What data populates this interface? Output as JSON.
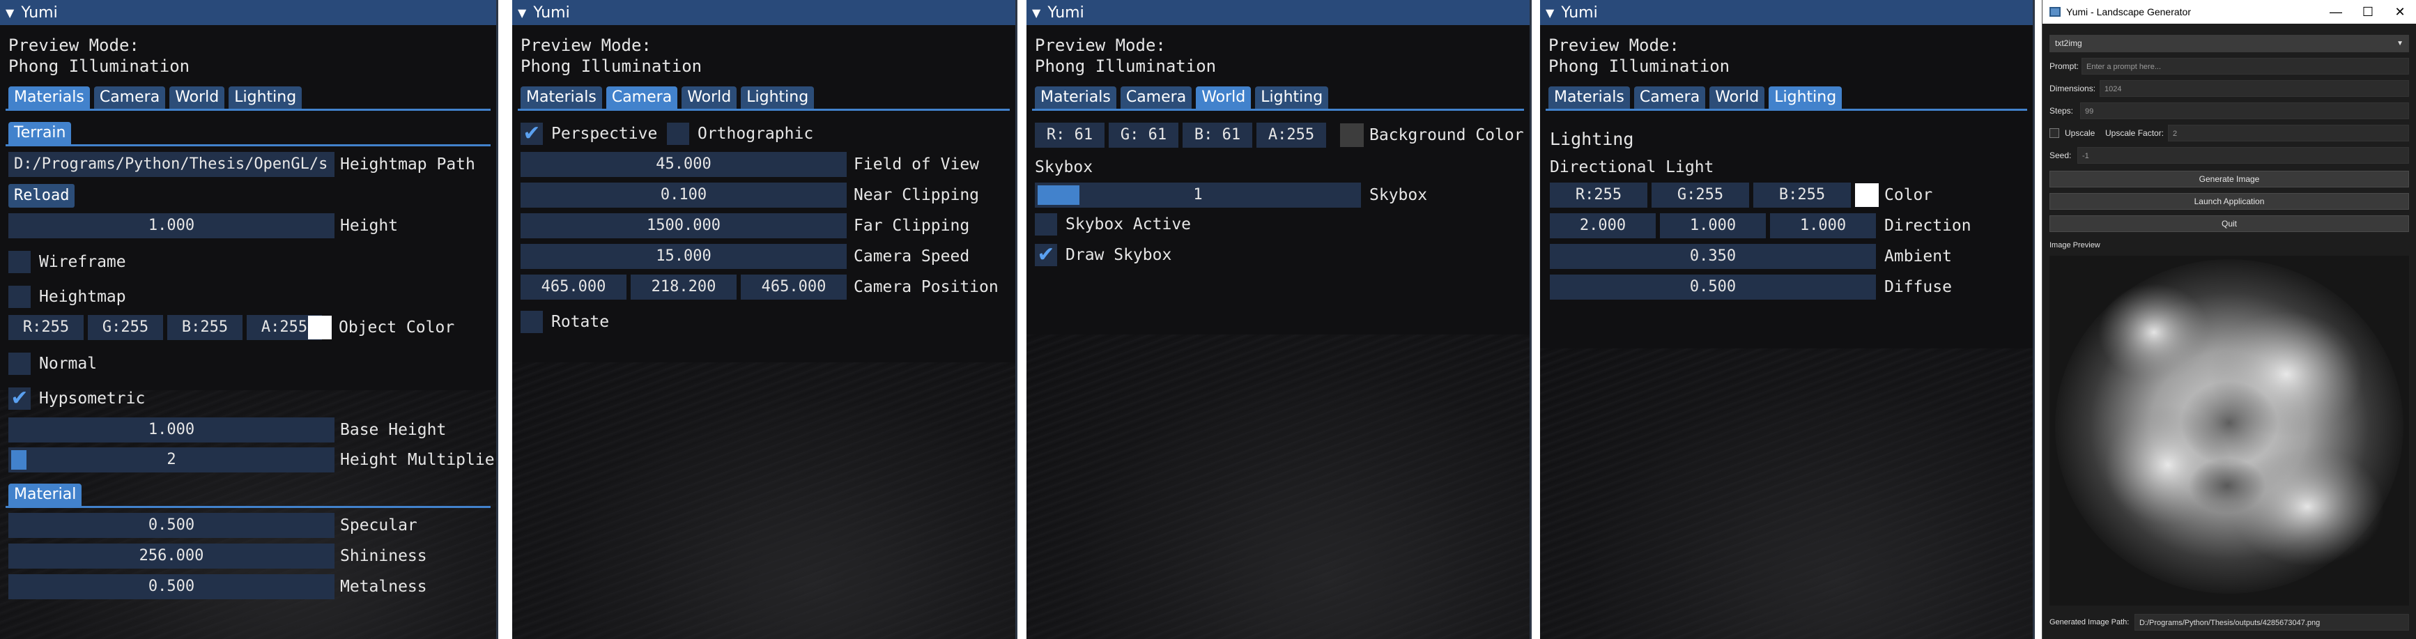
{
  "imgui": {
    "window_title": "Yumi",
    "preview_mode_label": "Preview Mode:",
    "preview_mode_value": "Phong Illumination",
    "tabs": [
      "Materials",
      "Camera",
      "World",
      "Lighting"
    ]
  },
  "materials": {
    "section_terrain": "Terrain",
    "heightmap_path": "D:/Programs/Python/Thesis/OpenGL/s",
    "heightmap_path_label": "Heightmap Path",
    "reload": "Reload",
    "height_value": "1.000",
    "height_label": "Height",
    "wireframe": "Wireframe",
    "heightmap": "Heightmap",
    "color": {
      "r": "R:255",
      "g": "G:255",
      "b": "B:255",
      "a": "A:255",
      "swatch": "#ffffff"
    },
    "object_color_label": "Object Color",
    "normal": "Normal",
    "hypsometric": "Hypsometric",
    "base_height_value": "1.000",
    "base_height_label": "Base Height",
    "height_multiplier_value": "2",
    "height_multiplier_label": "Height Multiplier",
    "height_multiplier_fill": 0.0,
    "section_material": "Material",
    "specular_value": "0.500",
    "specular_label": "Specular",
    "shininess_value": "256.000",
    "shininess_label": "Shininess",
    "metalness_value": "0.500",
    "metalness_label": "Metalness",
    "wireframe_checked": false,
    "heightmap_checked": false,
    "normal_checked": false,
    "hypsometric_checked": true
  },
  "camera": {
    "perspective": "Perspective",
    "orthographic": "Orthographic",
    "perspective_checked": true,
    "orthographic_checked": false,
    "fov_value": "45.000",
    "fov_label": "Field of View",
    "near_value": "0.100",
    "near_label": "Near Clipping",
    "far_value": "1500.000",
    "far_label": "Far Clipping",
    "speed_value": "15.000",
    "speed_label": "Camera Speed",
    "pos_x": "465.000",
    "pos_y": "218.200",
    "pos_z": "465.000",
    "pos_label": "Camera Position",
    "rotate": "Rotate",
    "rotate_checked": false
  },
  "world": {
    "bg": {
      "r": "R: 61",
      "g": "G: 61",
      "b": "B: 61",
      "a": "A:255",
      "swatch": "#3d3d3d"
    },
    "bg_label": "Background Color",
    "skybox_heading": "Skybox",
    "skybox_value": "1",
    "skybox_label": "Skybox",
    "skybox_fill": 0.13,
    "skybox_active": "Skybox Active",
    "skybox_active_checked": false,
    "draw_skybox": "Draw Skybox",
    "draw_skybox_checked": true
  },
  "lighting": {
    "heading": "Lighting",
    "directional": "Directional Light",
    "color": {
      "r": "R:255",
      "g": "G:255",
      "b": "B:255",
      "swatch": "#ffffff"
    },
    "color_label": "Color",
    "dir_x": "2.000",
    "dir_y": "1.000",
    "dir_z": "1.000",
    "direction_label": "Direction",
    "ambient_value": "0.350",
    "ambient_label": "Ambient",
    "diffuse_value": "0.500",
    "diffuse_label": "Diffuse"
  },
  "app": {
    "title": "Yumi - Landscape Generator",
    "mode": "txt2img",
    "prompt_label": "Prompt:",
    "prompt_placeholder": "Enter a prompt here...",
    "dimensions_label": "Dimensions:",
    "dimensions_value": "1024",
    "steps_label": "Steps:",
    "steps_value": "99",
    "upscale_label": "Upscale",
    "upscale_factor_label": "Upscale Factor:",
    "upscale_factor_value": "2",
    "seed_label": "Seed:",
    "seed_value": "-1",
    "generate_button": "Generate Image",
    "launch_button": "Launch Application",
    "quit_button": "Quit",
    "image_preview_label": "Image Preview",
    "generated_path_label": "Generated Image Path:",
    "generated_path_value": "D:/Programs/Python/Thesis/outputs/4285673047.png",
    "minimize_glyph": "—",
    "maximize_glyph": "☐",
    "close_glyph": "✕"
  }
}
